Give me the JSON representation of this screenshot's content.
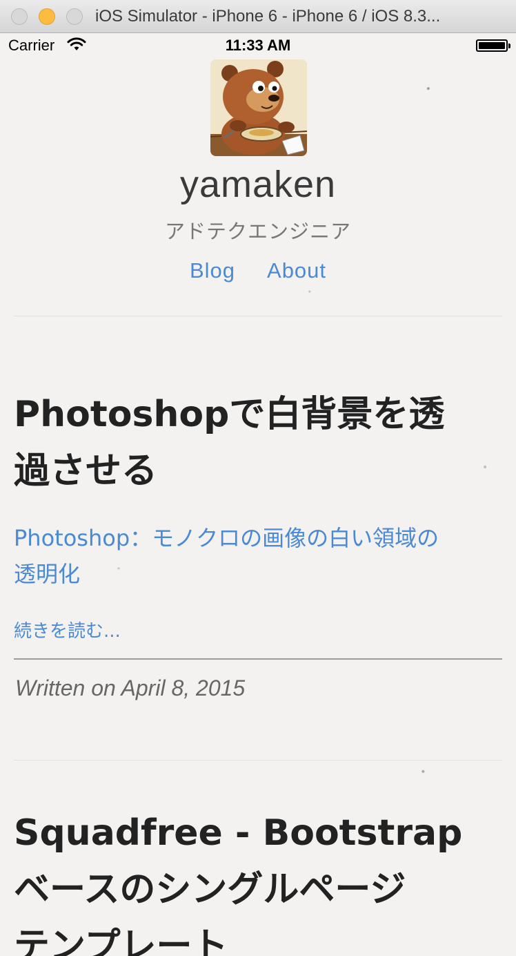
{
  "window": {
    "title": "iOS Simulator - iPhone 6 - iPhone 6 / iOS 8.3..."
  },
  "statusbar": {
    "carrier": "Carrier",
    "time": "11:33 AM"
  },
  "site": {
    "name": "yamaken",
    "description": "アドテクエンジニア",
    "avatar_icon": "bear-character-avatar"
  },
  "nav": {
    "items": [
      {
        "label": "Blog"
      },
      {
        "label": "About"
      }
    ]
  },
  "posts": [
    {
      "title_line1": "Photoshopで白背景を透",
      "title_line2": "過させる",
      "excerpt_line1": "Photoshop：モノクロの画像の白い領域の",
      "excerpt_line2": "透明化",
      "read_more": "続きを読む...",
      "date": "Written on April 8, 2015"
    },
    {
      "title_line1": "Squadfree - Bootstrap",
      "title_line2": "ベースのシングルページ",
      "title_line3": "テンプレート"
    }
  ],
  "colors": {
    "link": "#4a89d4",
    "title_text": "#222222",
    "background": "#f3f2f0"
  }
}
